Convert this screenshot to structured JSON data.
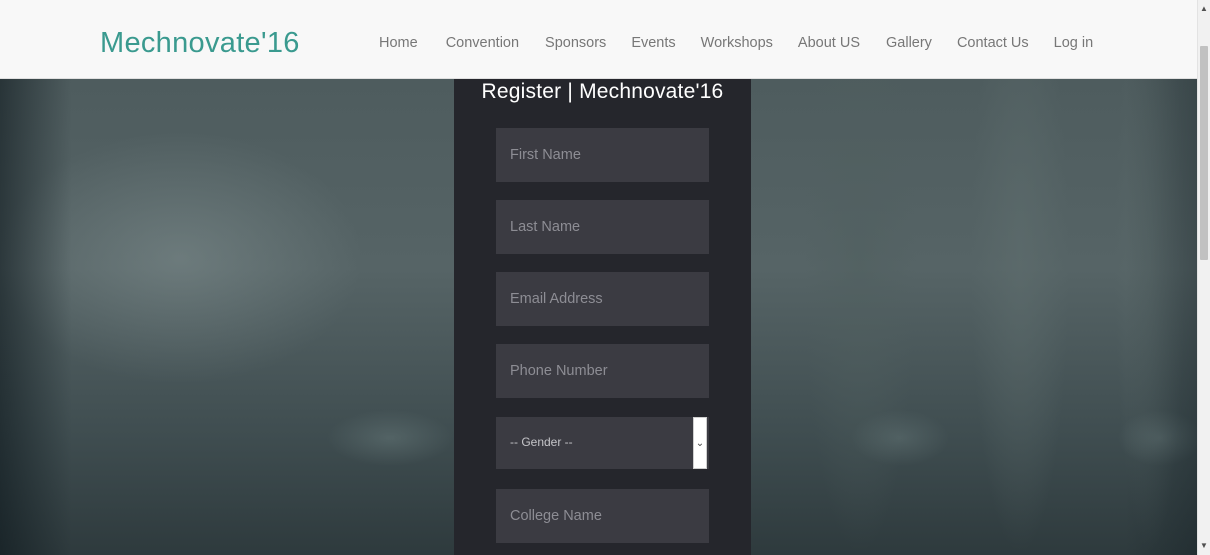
{
  "brand": "Mechnovate'16",
  "nav": {
    "items": [
      "Home",
      "Convention",
      "Sponsors",
      "Events",
      "Workshops",
      "About US",
      "Gallery",
      "Contact Us",
      "Log in"
    ]
  },
  "form": {
    "title": "Register | Mechnovate'16",
    "first_name_placeholder": "First Name",
    "last_name_placeholder": "Last Name",
    "email_placeholder": "Email Address",
    "phone_placeholder": "Phone Number",
    "gender_selected": "-- Gender --",
    "college_placeholder": "College Name"
  },
  "icons": {
    "select_arrow": "chevron-down-icon",
    "scroll_up": "triangle-up-icon",
    "scroll_down": "triangle-down-icon"
  },
  "colors": {
    "brand": "#3a9a8f",
    "panel": "#25262c",
    "field": "#3b3b42"
  }
}
